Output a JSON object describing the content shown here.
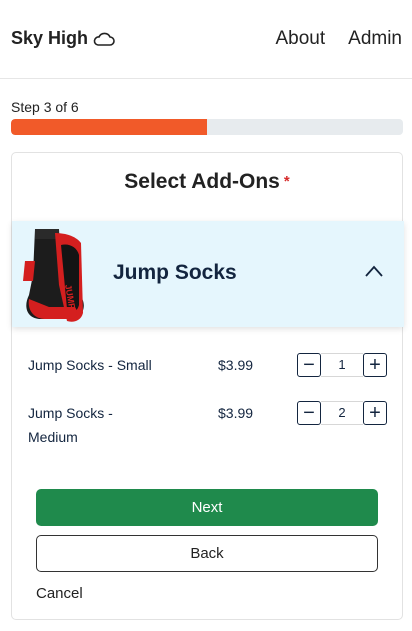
{
  "header": {
    "brand": "Sky High",
    "nav": [
      "About",
      "Admin"
    ]
  },
  "progress": {
    "label": "Step 3 of 6",
    "fraction": 0.5,
    "color": "#f15a29"
  },
  "card": {
    "title": "Select Add-Ons",
    "required_mark": "*",
    "accordion": {
      "title": "Jump Socks",
      "image_label": "JUMP",
      "expanded": true
    },
    "items": [
      {
        "name": "Jump Socks - Small",
        "price": "$3.99",
        "quantity": "1"
      },
      {
        "name": "Jump Socks - Medium",
        "price": "$3.99",
        "quantity": "2"
      }
    ],
    "next_label": "Next",
    "back_label": "Back",
    "cancel_label": "Cancel"
  },
  "colors": {
    "accent_green": "#1f8a4c",
    "accordion_bg": "#e5f6fd",
    "navy_text": "#13253f"
  }
}
